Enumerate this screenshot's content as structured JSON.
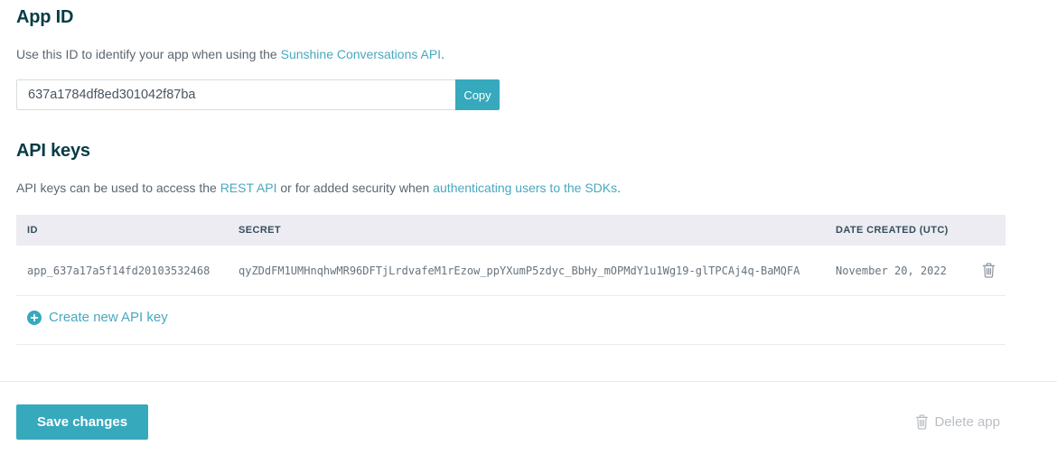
{
  "app_id_section": {
    "title": "App ID",
    "description_prefix": "Use this ID to identify your app when using the ",
    "description_link": "Sunshine Conversations API",
    "description_suffix": ".",
    "input_value": "637a1784df8ed301042f87ba",
    "copy_label": "Copy"
  },
  "api_keys_section": {
    "title": "API keys",
    "description_part1": "API keys can be used to access the ",
    "description_link1": "REST API",
    "description_part2": " or for added security when ",
    "description_link2": "authenticating users to the SDKs",
    "description_part3": ".",
    "table": {
      "headers": [
        "ID",
        "SECRET",
        "DATE CREATED (UTC)"
      ],
      "rows": [
        {
          "id": "app_637a17a5f14fd20103532468",
          "secret": "qyZDdFM1UMHnqhwMR96DFTjLrdvafeM1rEzow_ppYXumP5zdyc_BbHy_mOPMdY1u1Wg19-glTPCAj4q-BaMQFA",
          "date_created": "November 20, 2022"
        }
      ]
    },
    "create_link_label": "Create new API key"
  },
  "footer": {
    "save_label": "Save changes",
    "delete_label": "Delete app"
  },
  "colors": {
    "accent_teal": "#36a9bd",
    "link_teal": "#49a8bf",
    "heading_dark_teal": "#073b45",
    "table_header_bg": "#ececf2"
  },
  "icons": {
    "trash_row": "trash-icon",
    "trash_delete": "trash-icon",
    "plus_circle": "plus-circle-icon"
  }
}
